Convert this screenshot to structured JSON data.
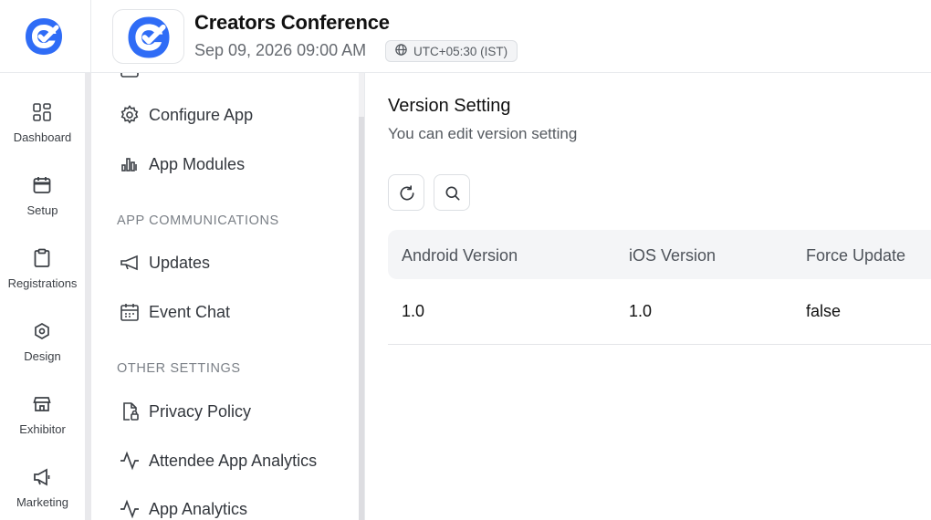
{
  "header": {
    "event_title": "Creators Conference",
    "event_datetime": "Sep 09, 2026 09:00 AM",
    "timezone": "UTC+05:30 (IST)"
  },
  "rail": {
    "items": [
      {
        "label": "Dashboard",
        "icon": "dashboard-icon"
      },
      {
        "label": "Setup",
        "icon": "calendar-icon"
      },
      {
        "label": "Registrations",
        "icon": "clipboard-icon"
      },
      {
        "label": "Design",
        "icon": "design-icon"
      },
      {
        "label": "Exhibitor",
        "icon": "store-icon"
      },
      {
        "label": "Marketing",
        "icon": "megaphone-icon"
      }
    ]
  },
  "menu": {
    "items": [
      {
        "label": "Configure App",
        "icon": "gear-icon"
      },
      {
        "label": "App Modules",
        "icon": "bar-chart-icon"
      },
      {
        "label": "Updates",
        "icon": "megaphone-icon"
      },
      {
        "label": "Event Chat",
        "icon": "calendar-icon"
      },
      {
        "label": "Privacy Policy",
        "icon": "file-lock-icon"
      },
      {
        "label": "Attendee App Analytics",
        "icon": "activity-icon"
      },
      {
        "label": "App Analytics",
        "icon": "activity-icon"
      }
    ],
    "sections": {
      "communications": "APP COMMUNICATIONS",
      "other": "OTHER SETTINGS"
    }
  },
  "content": {
    "title": "Version Setting",
    "subtitle": "You can edit version setting",
    "table": {
      "headers": [
        "Android Version",
        "iOS Version",
        "Force Update"
      ],
      "rows": [
        [
          "1.0",
          "1.0",
          "false"
        ]
      ]
    }
  },
  "colors": {
    "brand": "#2f6cf6",
    "text": "#1f2328",
    "muted": "#7b8087"
  }
}
